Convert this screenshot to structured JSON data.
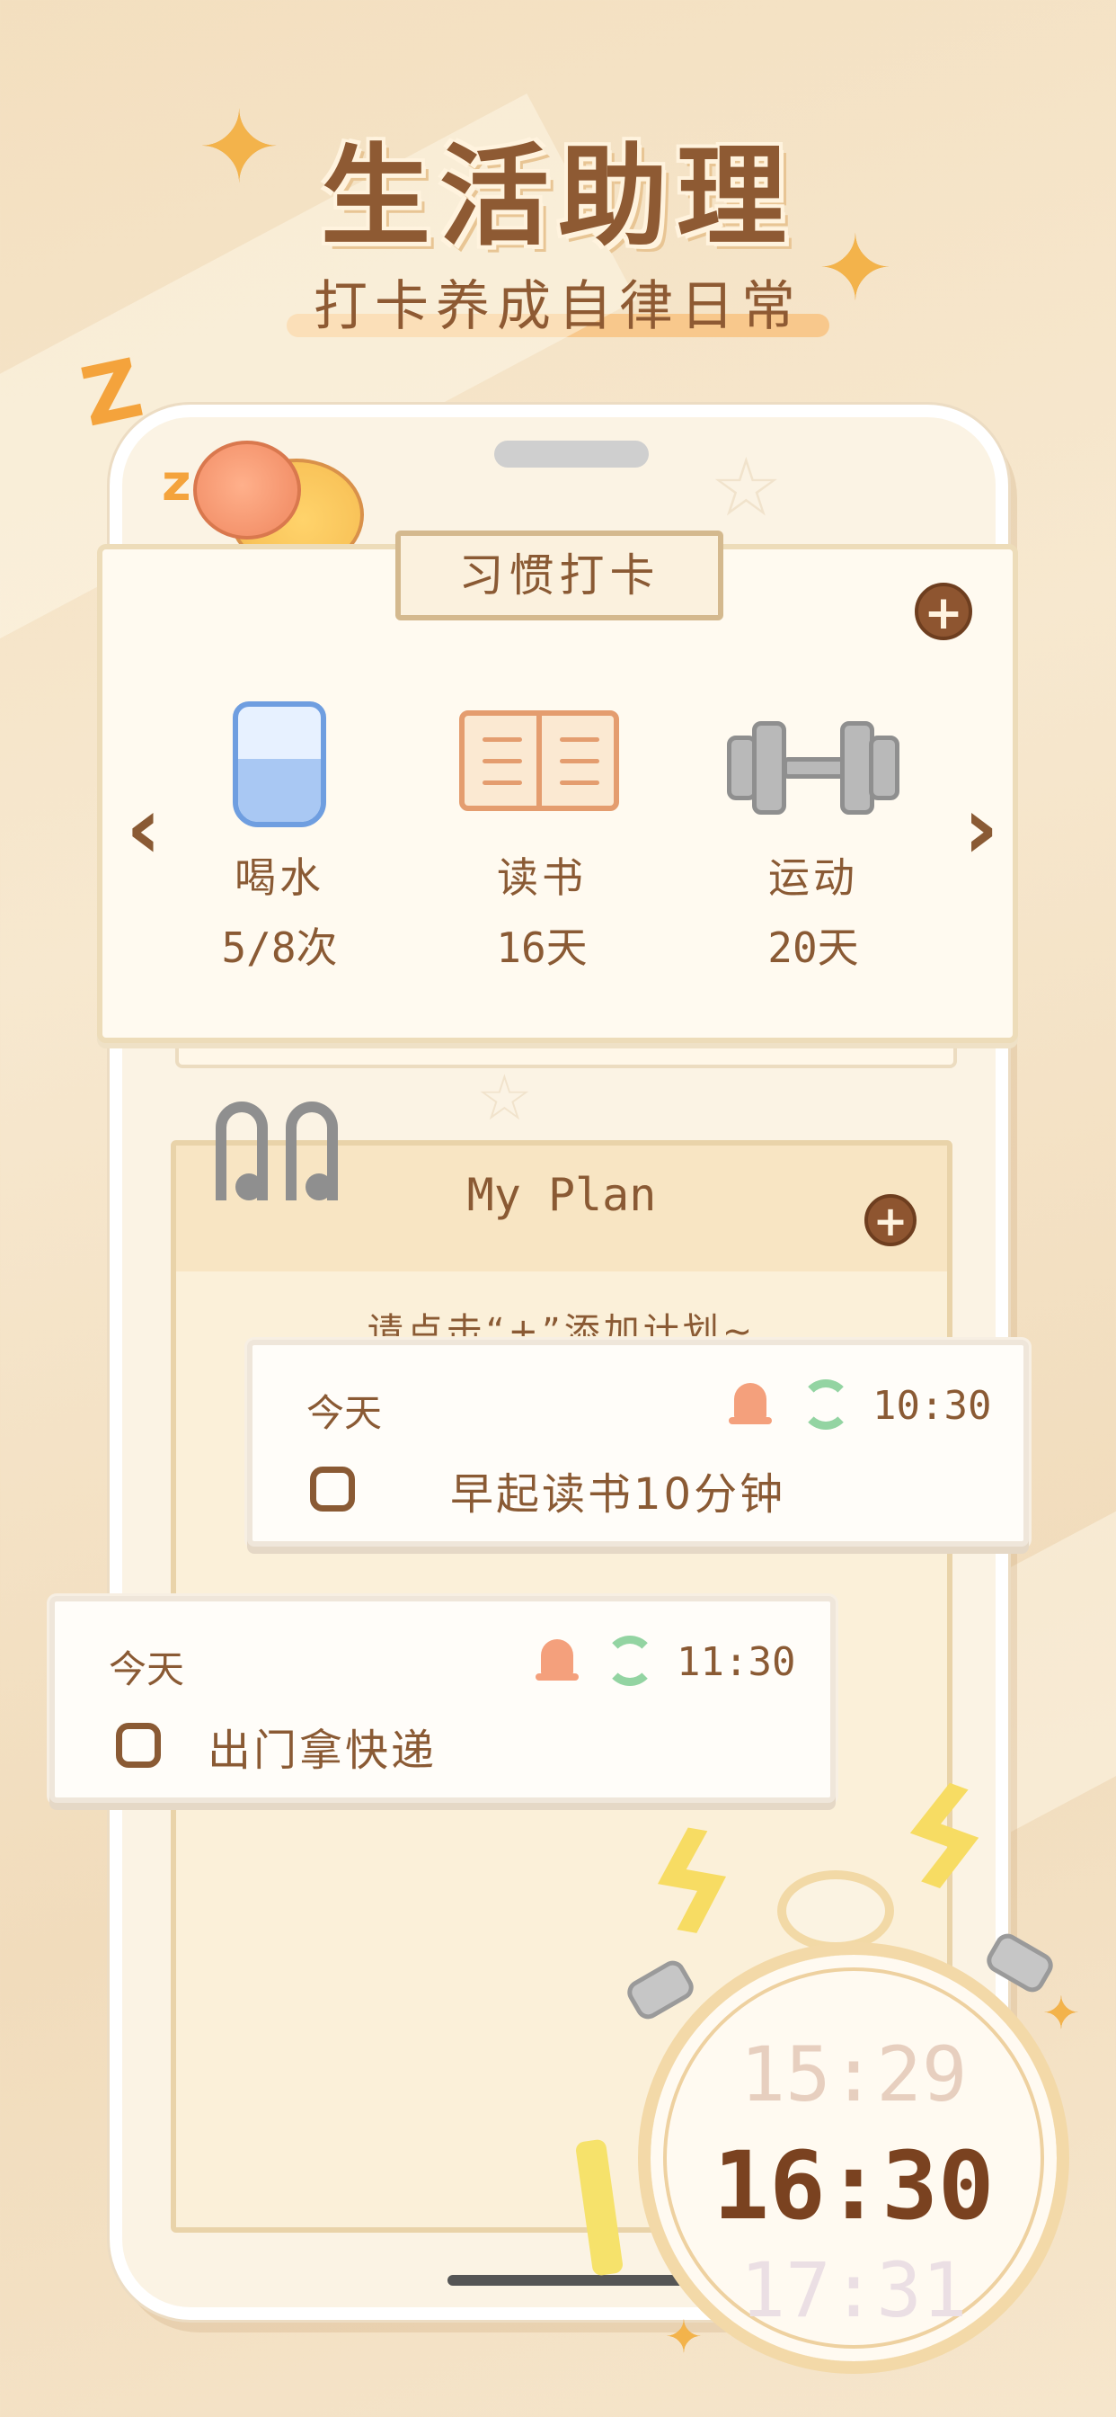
{
  "header": {
    "title": "生活助理",
    "subtitle": "打卡养成自律日常"
  },
  "habit_card": {
    "title": "习惯打卡",
    "add_icon": "plus-circle-icon",
    "prev_icon": "chevron-left-icon",
    "next_icon": "chevron-right-icon",
    "items": [
      {
        "icon": "water-glass-icon",
        "name": "喝水",
        "count": "5/8次"
      },
      {
        "icon": "book-icon",
        "name": "读书",
        "count": "16天"
      },
      {
        "icon": "dumbbell-icon",
        "name": "运动",
        "count": "20天"
      }
    ]
  },
  "plan": {
    "title": "My Plan",
    "hint": "请点击“+”添加计划~",
    "tasks": [
      {
        "day": "今天",
        "time": "10:30",
        "label": "早起读书10分钟",
        "reminder_icon": "bell-icon",
        "repeat_icon": "repeat-icon"
      },
      {
        "day": "今天",
        "time": "11:30",
        "label": "出门拿快递",
        "reminder_icon": "bell-icon",
        "repeat_icon": "repeat-icon"
      }
    ]
  },
  "clock": {
    "prev_time": "15:29",
    "current_time": "16:30",
    "next_time": "17:31"
  },
  "colors": {
    "brown": "#8a5a34",
    "cream": "#fffaf0",
    "accent_orange": "#f8c88c",
    "bell": "#f4a07c",
    "repeat": "#93d4a2"
  }
}
